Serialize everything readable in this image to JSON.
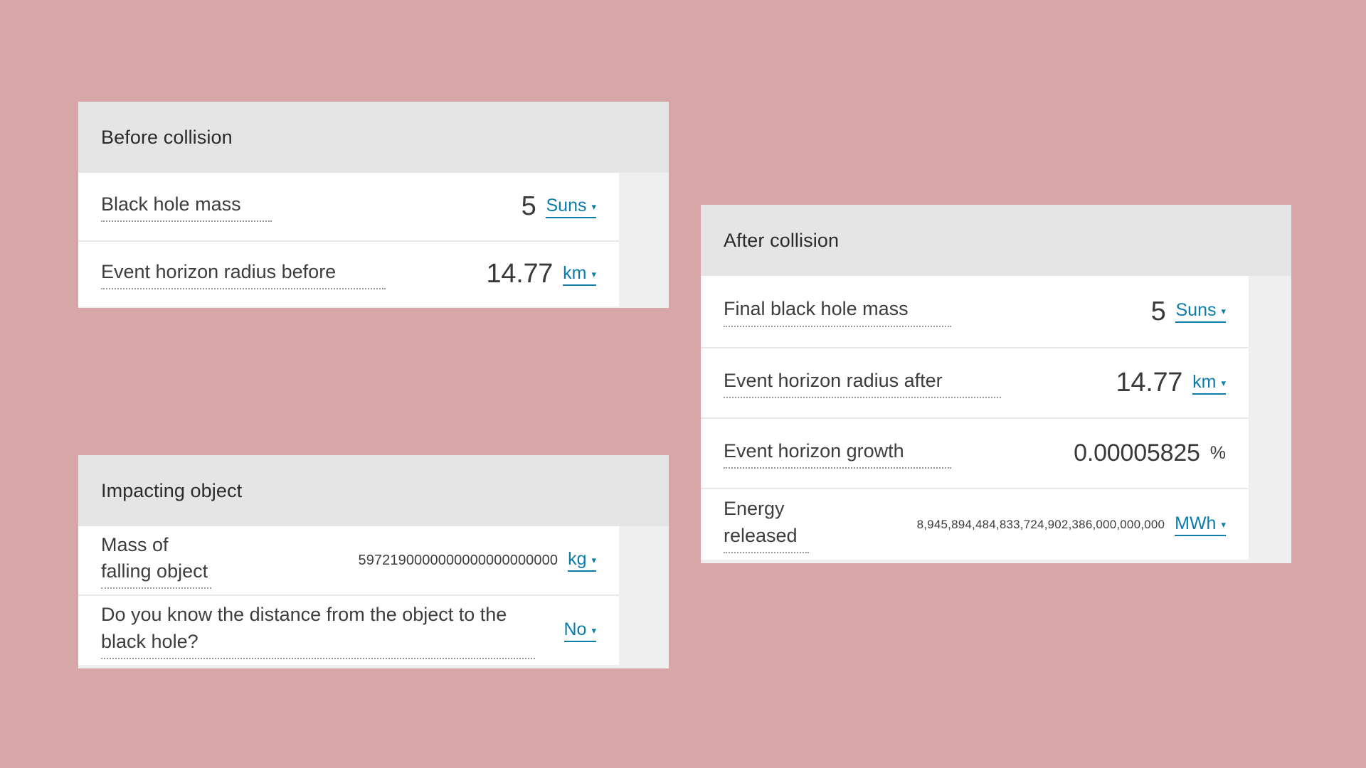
{
  "background_color": "#d7a6a9",
  "accent_color": "#0c7dab",
  "cards": [
    {
      "id": "before-collision",
      "title": "Before collision",
      "rows": [
        {
          "id": "black-hole-mass",
          "label": "Black hole mass",
          "value": "5",
          "unit": "Suns",
          "unit_interactive": true,
          "caret": "▾"
        },
        {
          "id": "event-horizon-radius-before",
          "label": "Event horizon radius before",
          "value": "14.77",
          "unit": "km",
          "unit_interactive": true,
          "caret": "▾"
        }
      ]
    },
    {
      "id": "impacting-object",
      "title": "Impacting object",
      "rows": [
        {
          "id": "mass-of-falling-object",
          "label": "Mass of falling object",
          "value": "5972190000000000000000000",
          "unit": "kg",
          "unit_interactive": true,
          "caret": "▾"
        },
        {
          "id": "know-distance-question",
          "label": "Do you know the distance from the object to the black hole?",
          "value": "",
          "unit": "No",
          "unit_interactive": true,
          "caret": "▾"
        }
      ]
    },
    {
      "id": "after-collision",
      "title": "After collision",
      "rows": [
        {
          "id": "final-black-hole-mass",
          "label": "Final black hole mass",
          "value": "5",
          "unit": "Suns",
          "unit_interactive": true,
          "caret": "▾"
        },
        {
          "id": "event-horizon-radius-after",
          "label": "Event horizon radius after",
          "value": "14.77",
          "unit": "km",
          "unit_interactive": true,
          "caret": "▾"
        },
        {
          "id": "event-horizon-growth",
          "label": "Event horizon growth",
          "value": "0.00005825",
          "unit": "%",
          "unit_interactive": false,
          "caret": ""
        },
        {
          "id": "energy-released",
          "label": "Energy released",
          "value": "8,945,894,484,833,724,902,386,000,000,000",
          "unit": "MWh",
          "unit_interactive": true,
          "caret": "▾"
        }
      ]
    }
  ]
}
